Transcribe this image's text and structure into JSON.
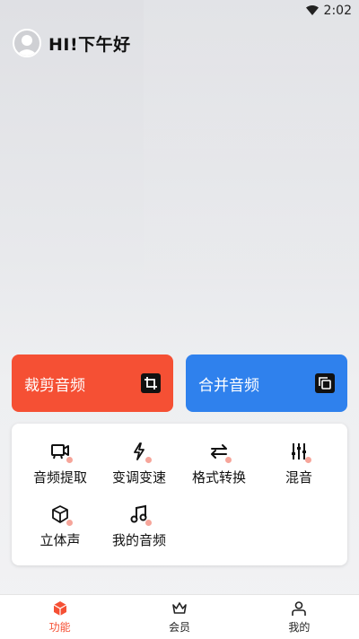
{
  "status": {
    "time": "2:02"
  },
  "header": {
    "greeting": "HI!下午好"
  },
  "cards": {
    "trim": {
      "label": "裁剪音频",
      "color": "#f55034"
    },
    "merge": {
      "label": "合并音频",
      "color": "#2f81ed"
    }
  },
  "tools": [
    {
      "label": "音频提取",
      "icon": "video-icon"
    },
    {
      "label": "变调变速",
      "icon": "lightning-icon"
    },
    {
      "label": "格式转换",
      "icon": "swap-arrows-icon"
    },
    {
      "label": "混音",
      "icon": "mixer-sliders-icon"
    },
    {
      "label": "立体声",
      "icon": "cube-icon"
    },
    {
      "label": "我的音频",
      "icon": "music-note-icon"
    }
  ],
  "tabbar": {
    "items": [
      {
        "label": "功能",
        "icon": "cube-icon",
        "active": true
      },
      {
        "label": "会员",
        "icon": "crown-icon",
        "active": false
      },
      {
        "label": "我的",
        "icon": "person-icon",
        "active": false
      }
    ]
  },
  "colors": {
    "accent": "#f55034",
    "blue": "#2f81ed",
    "dot": "#f6a59a"
  }
}
